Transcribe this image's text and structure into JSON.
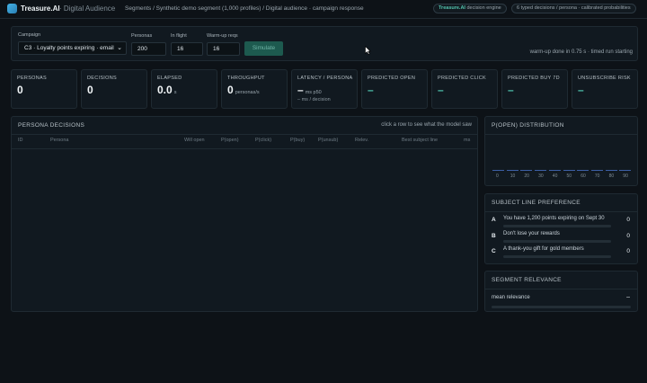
{
  "header": {
    "brand": "Treasure.AI",
    "section": "· Digital Audience",
    "breadcrumb": "Segments / Synthetic demo segment (1,000 profiles) / Digital audience · campaign response",
    "pill_engine_brand": "Treasure.AI",
    "pill_engine_text": "decision engine",
    "pill_info": "6 typed decisions / persona · calibrated probabilities"
  },
  "controls": {
    "campaign_label": "Campaign",
    "campaign_value": "C3 · Loyalty points expiring · email",
    "personas_label": "Personas",
    "personas_value": "200",
    "inflight_label": "In flight",
    "inflight_value": "16",
    "warmup_label": "Warm-up reqs",
    "warmup_value": "16",
    "simulate_label": "Simulate",
    "status": "warm-up done in 0.75 s · timed run starting"
  },
  "kpis": [
    {
      "label": "PERSONAS",
      "value": "0",
      "unit": "",
      "sub": ""
    },
    {
      "label": "DECISIONS",
      "value": "0",
      "unit": "",
      "sub": ""
    },
    {
      "label": "ELAPSED",
      "value": "0.0",
      "unit": "s",
      "sub": ""
    },
    {
      "label": "THROUGHPUT",
      "value": "0",
      "unit": "personas/s",
      "sub": ""
    },
    {
      "label": "LATENCY / PERSONA",
      "value": "–",
      "unit": "ms p50",
      "sub": "– ms / decision"
    },
    {
      "label": "PREDICTED OPEN",
      "value": "–",
      "unit": "",
      "sub": ""
    },
    {
      "label": "PREDICTED CLICK",
      "value": "–",
      "unit": "",
      "sub": ""
    },
    {
      "label": "PREDICTED BUY 7D",
      "value": "–",
      "unit": "",
      "sub": ""
    },
    {
      "label": "UNSUBSCRIBE RISK",
      "value": "–",
      "unit": "",
      "sub": ""
    }
  ],
  "decisions": {
    "title": "PERSONA DECISIONS",
    "hint": "click a row to see what the model saw",
    "columns": [
      "ID",
      "Persona",
      "Will open",
      "P(open)",
      "P(click)",
      "P(buy)",
      "P(unsub)",
      "Relev.",
      "Best subject line",
      "ms"
    ]
  },
  "distribution": {
    "title": "P(OPEN) DISTRIBUTION",
    "ticks": [
      "0",
      "10",
      "20",
      "30",
      "40",
      "50",
      "60",
      "70",
      "80",
      "90"
    ]
  },
  "subjects": {
    "title": "SUBJECT LINE PREFERENCE",
    "items": [
      {
        "letter": "A",
        "text": "You have 1,200 points expiring on Sept 30",
        "value": "0"
      },
      {
        "letter": "B",
        "text": "Don't lose your rewards",
        "value": "0"
      },
      {
        "letter": "C",
        "text": "A thank-you gift for gold members",
        "value": "0"
      }
    ]
  },
  "relevance": {
    "title": "SEGMENT RELEVANCE",
    "label": "mean relevance",
    "value": "–"
  },
  "colors": {
    "accent": "#4fc3ae",
    "background": "#0d1217",
    "panel": "#111920",
    "bar": "#3d5fa6"
  }
}
